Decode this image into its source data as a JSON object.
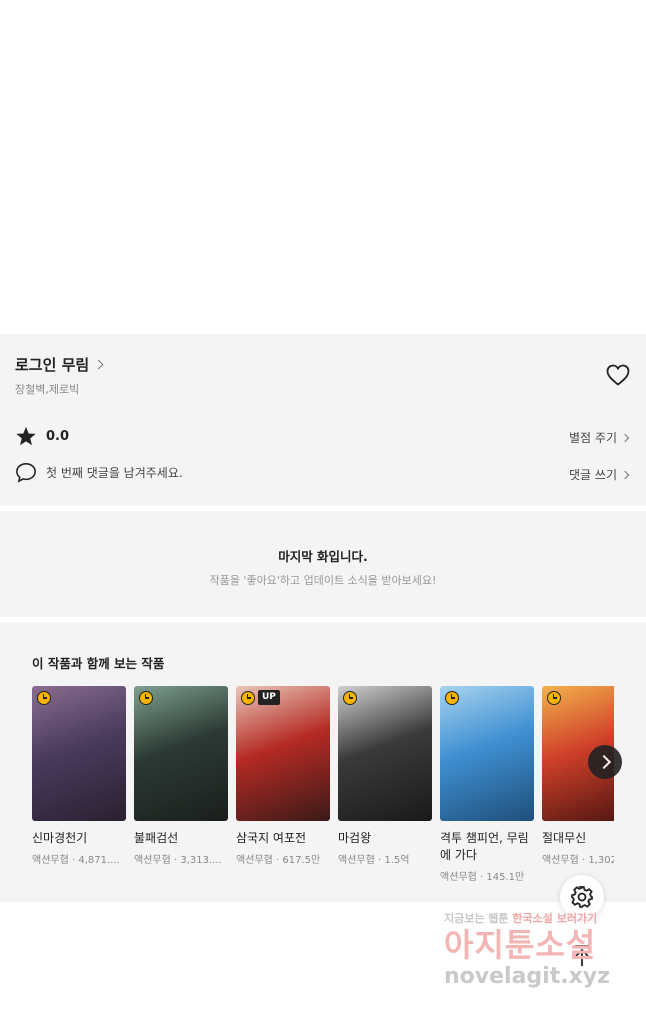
{
  "work": {
    "title": "로그인 무림",
    "authors": "장철벽,제로빅",
    "rating": "0.0",
    "rate_link": "별점 주기",
    "comment_prompt": "첫 번째 댓글을 남겨주세요.",
    "comment_link": "댓글 쓰기"
  },
  "last_episode": {
    "title": "마지막 화입니다.",
    "subtitle": "작품을 '좋아요'하고 업데이트 소식을 받아보세요!"
  },
  "recommendations": {
    "title": "이 작품과 함께 보는 작품",
    "items": [
      {
        "title": "신마경천기",
        "genre": "액션무협",
        "views": "4,871....",
        "badge": "",
        "colors": [
          "#4a3b5e",
          "#8a6d8f",
          "#2a2030"
        ]
      },
      {
        "title": "불패검선",
        "genre": "액션무협",
        "views": "3,313....",
        "badge": "",
        "colors": [
          "#2c3a34",
          "#7ea08e",
          "#1b1f1c"
        ]
      },
      {
        "title": "삼국지 여포전",
        "genre": "액션무협",
        "views": "617.5만",
        "badge": "UP",
        "colors": [
          "#b52a24",
          "#e8c7b8",
          "#3a1a18"
        ]
      },
      {
        "title": "마검왕",
        "genre": "액션무협",
        "views": "1.5억",
        "badge": "",
        "colors": [
          "#3a3a3a",
          "#cfcfcf",
          "#1a1a1a"
        ]
      },
      {
        "title": "격투 챔피언, 무림에 가다",
        "genre": "액션무협",
        "views": "145.1만",
        "badge": "",
        "colors": [
          "#3f8fd2",
          "#a7d3ef",
          "#1f4f7a"
        ]
      },
      {
        "title": "절대무신",
        "genre": "액션무협",
        "views": "1,302...",
        "badge": "",
        "colors": [
          "#d0402a",
          "#f2b24c",
          "#4a1410"
        ]
      }
    ]
  },
  "watermark": {
    "line1_a": "지금보는 웹툰 ",
    "line1_b": "한국소설 보러가기",
    "line2": "아지툰소설",
    "line3": "novelagit.xyz"
  },
  "icons": {
    "heart": "heart-outline-icon",
    "star": "star-icon",
    "comment": "speech-bubble-icon",
    "gear": "gear-icon",
    "top": "arrow-up-icon"
  }
}
